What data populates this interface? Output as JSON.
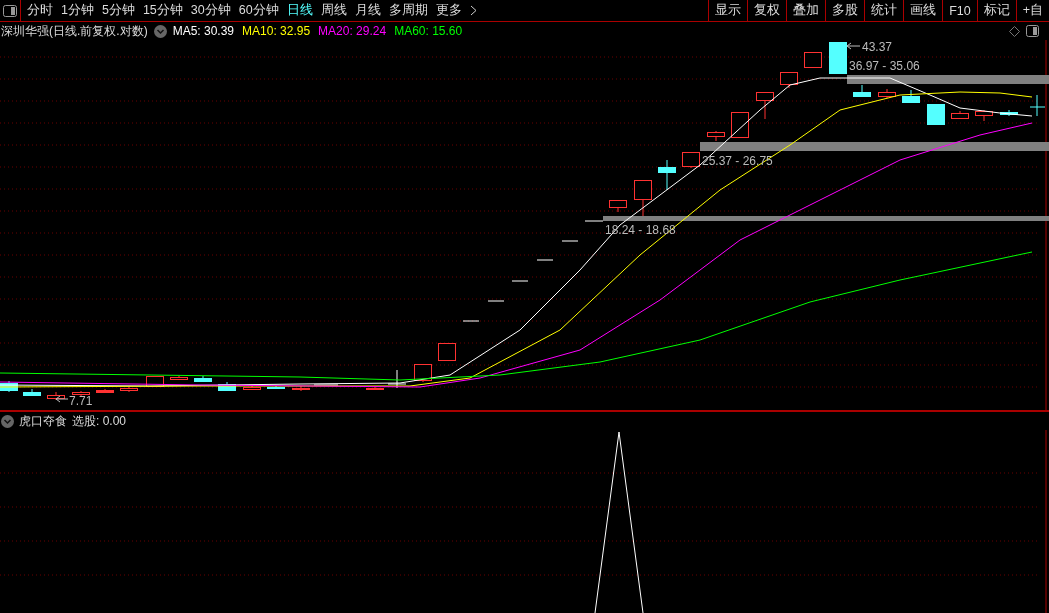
{
  "toolbar": {
    "periods": [
      {
        "label": "分时",
        "selected": false
      },
      {
        "label": "1分钟",
        "selected": false
      },
      {
        "label": "5分钟",
        "selected": false
      },
      {
        "label": "15分钟",
        "selected": false
      },
      {
        "label": "30分钟",
        "selected": false
      },
      {
        "label": "60分钟",
        "selected": false
      },
      {
        "label": "日线",
        "selected": true
      },
      {
        "label": "周线",
        "selected": false
      },
      {
        "label": "月线",
        "selected": false
      },
      {
        "label": "多周期",
        "selected": false
      },
      {
        "label": "更多",
        "selected": false
      }
    ],
    "buttons": [
      "显示",
      "复权",
      "叠加",
      "多股",
      "统计",
      "画线",
      "F10",
      "标记",
      "+自"
    ]
  },
  "legend": {
    "title": "深圳华强(日线.前复权.对数)",
    "ma": [
      {
        "name": "MA5:",
        "value": "30.39",
        "color": "#ffffff"
      },
      {
        "name": "MA10:",
        "value": "32.95",
        "color": "#ffff00"
      },
      {
        "name": "MA20:",
        "value": "29.24",
        "color": "#ff00ff"
      },
      {
        "name": "MA60:",
        "value": "15.60",
        "color": "#00ff00"
      }
    ]
  },
  "chart": {
    "high_label": "43.37",
    "low_label": "7.71",
    "zones": [
      "36.97 - 35.06",
      "25.37 - 26.75",
      "18.24 - 18.68"
    ]
  },
  "indicator": {
    "name": "虎口夺食",
    "label": "选股:",
    "value": "0.00"
  }
}
